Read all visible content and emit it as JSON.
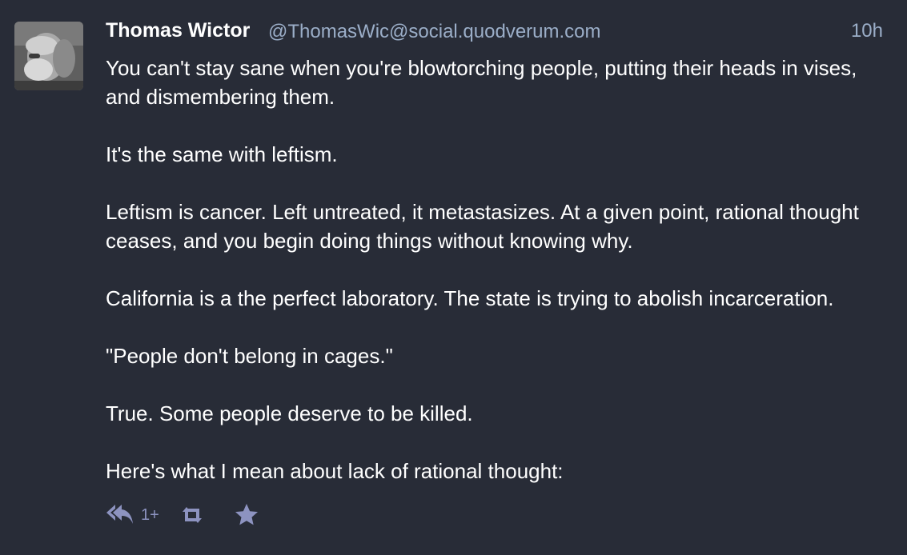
{
  "status": {
    "author": {
      "display_name": "Thomas Wictor",
      "handle": "@ThomasWic@social.quodverum.com",
      "avatar_icon": "avatar-photo"
    },
    "timestamp": "10h",
    "paragraphs": [
      "You can't stay sane when you're blowtorching people, putting their heads in vises, and dismembering them.",
      "It's the same with leftism.",
      "Leftism is cancer. Left untreated, it metastasizes. At a given point, rational thought ceases, and you begin doing things without knowing why.",
      "California is a the perfect laboratory. The state is trying to abolish incarceration.",
      "\"People don't belong in cages.\"",
      "True. Some people deserve to be killed.",
      "Here's what I mean about lack of rational thought:"
    ],
    "actions": {
      "reply_count": "1+",
      "reply_icon": "reply-all-icon",
      "boost_icon": "boost-icon",
      "favourite_icon": "star-icon"
    }
  },
  "colors": {
    "background": "#282c37",
    "text": "#ffffff",
    "secondary_text": "#9baec8",
    "action_icons": "#8d93c0"
  }
}
